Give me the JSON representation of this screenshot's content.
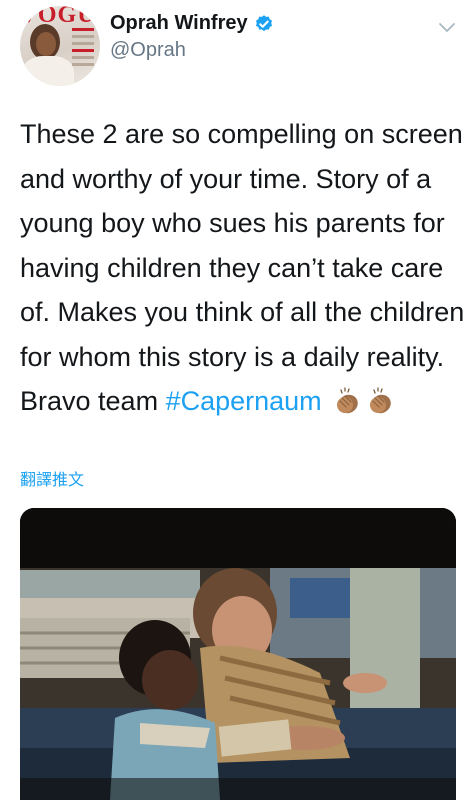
{
  "header": {
    "display_name": "Oprah Winfrey",
    "handle": "@Oprah",
    "avatar_masthead": "VOGUE"
  },
  "tweet": {
    "text_before_hashtag": "These 2 are so compelling on screen and worthy of your time. Story of a young boy who sues his parents for having children they can’t take care of. Makes you think of all the children for whom this story is a daily reality. Bravo team ",
    "hashtag": "#Capernaum",
    "emoji": [
      "clapping-hands",
      "clapping-hands"
    ]
  },
  "translate_link": "翻譯推文",
  "colors": {
    "link": "#1da1f2",
    "text": "#14171a",
    "secondary": "#657786",
    "verified_badge": "#1da1f2"
  }
}
